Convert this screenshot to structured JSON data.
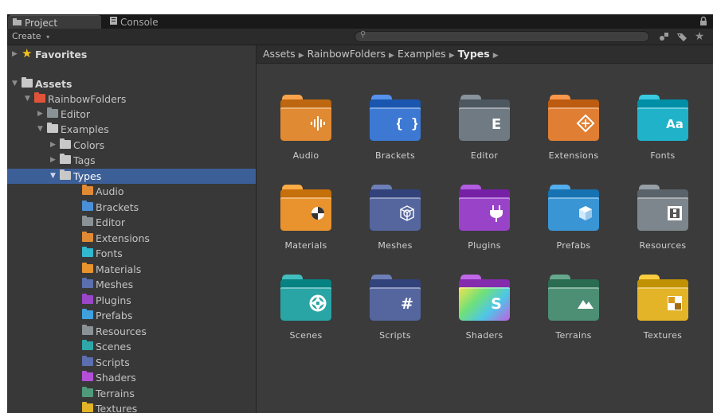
{
  "tabs": [
    {
      "label": "Project",
      "icon": "folder-icon"
    },
    {
      "label": "Console",
      "icon": "console-icon"
    }
  ],
  "toolbar": {
    "create_label": "Create",
    "create_icon": "chevron-down-icon",
    "search_placeholder": "",
    "buttons": [
      "search-by-type-icon",
      "search-by-label-icon",
      "favorites-star-icon"
    ]
  },
  "tree": [
    {
      "label": "Favorites",
      "arrow": "collapsed",
      "icon": "star",
      "bold": true
    },
    {
      "label": "Assets",
      "arrow": "expanded",
      "icon": "folder",
      "bold": true,
      "color": "#c8c8c8"
    },
    {
      "label": "RainbowFolders",
      "arrow": "expanded",
      "icon": "folder",
      "color": "#e0533a"
    },
    {
      "label": "Editor",
      "arrow": "collapsed",
      "icon": "folder",
      "color": "#8a9296"
    },
    {
      "label": "Examples",
      "arrow": "expanded",
      "icon": "folder",
      "color": "#c8c8c8"
    },
    {
      "label": "Colors",
      "arrow": "collapsed",
      "icon": "folder",
      "color": "#c8c8c8"
    },
    {
      "label": "Tags",
      "arrow": "collapsed",
      "icon": "folder",
      "color": "#c8c8c8"
    },
    {
      "label": "Types",
      "arrow": "expanded",
      "icon": "folder",
      "color": "#c8c8c8",
      "selected": true
    },
    {
      "label": "Audio",
      "icon": "folder",
      "color": "#e08a34"
    },
    {
      "label": "Brackets",
      "icon": "folder",
      "color": "#4a8fd8"
    },
    {
      "label": "Editor",
      "icon": "folder",
      "color": "#8a9296"
    },
    {
      "label": "Extensions",
      "icon": "folder",
      "color": "#e08a34"
    },
    {
      "label": "Fonts",
      "icon": "folder",
      "color": "#2fb8d0"
    },
    {
      "label": "Materials",
      "icon": "folder",
      "color": "#e8932e"
    },
    {
      "label": "Meshes",
      "icon": "folder",
      "color": "#5b6fae"
    },
    {
      "label": "Plugins",
      "icon": "folder",
      "color": "#9b45c9"
    },
    {
      "label": "Prefabs",
      "icon": "folder",
      "color": "#3fa0de"
    },
    {
      "label": "Resources",
      "icon": "folder",
      "color": "#8a9296"
    },
    {
      "label": "Scenes",
      "icon": "folder",
      "color": "#2fa6a8"
    },
    {
      "label": "Scripts",
      "icon": "folder",
      "color": "#5b6fae"
    },
    {
      "label": "Shaders",
      "icon": "folder",
      "color": "#b34fd6"
    },
    {
      "label": "Terrains",
      "icon": "folder",
      "color": "#4f9a7a"
    },
    {
      "label": "Textures",
      "icon": "folder",
      "color": "#e3b427"
    }
  ],
  "breadcrumb": [
    "Assets",
    "RainbowFolders",
    "Examples",
    "Types"
  ],
  "grid": [
    {
      "label": "Audio",
      "color": "#e08a34",
      "glyph": "audio-waveform-icon"
    },
    {
      "label": "Brackets",
      "color": "#3d79d2",
      "glyph": "curly-brackets-icon"
    },
    {
      "label": "Editor",
      "color": "#6f7a82",
      "glyph": "letter-e-icon"
    },
    {
      "label": "Extensions",
      "color": "#e07f33",
      "glyph": "diamond-plus-icon"
    },
    {
      "label": "Fonts",
      "color": "#1fb2c9",
      "glyph": "font-aa-icon"
    },
    {
      "label": "Materials",
      "color": "#e8932e",
      "glyph": "material-sphere-icon"
    },
    {
      "label": "Meshes",
      "color": "#55669e",
      "glyph": "mesh-cube-icon"
    },
    {
      "label": "Plugins",
      "color": "#9943c8",
      "glyph": "plug-icon"
    },
    {
      "label": "Prefabs",
      "color": "#3a95d4",
      "glyph": "prefab-cube-icon"
    },
    {
      "label": "Resources",
      "color": "#7d868c",
      "glyph": "resources-box-icon"
    },
    {
      "label": "Scenes",
      "color": "#2aa5a6",
      "glyph": "camera-shutter-icon"
    },
    {
      "label": "Scripts",
      "color": "#55669e",
      "glyph": "hash-icon"
    },
    {
      "label": "Shaders",
      "color": "#a84ed0",
      "glyph": "letter-s-icon"
    },
    {
      "label": "Terrains",
      "color": "#4d8f74",
      "glyph": "mountains-icon"
    },
    {
      "label": "Textures",
      "color": "#e3b427",
      "glyph": "texture-checker-icon"
    }
  ]
}
